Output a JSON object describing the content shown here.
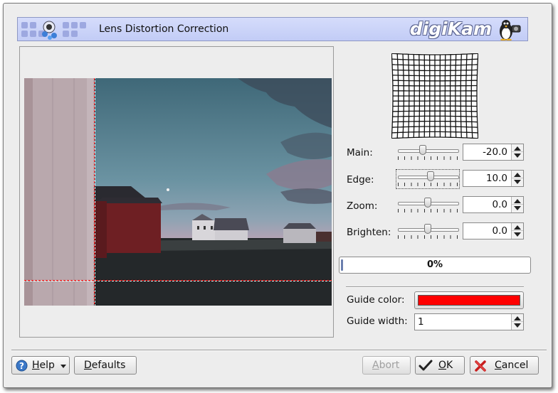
{
  "dialog": {
    "title": "Lens Distortion Correction",
    "logo_text": "digiKam"
  },
  "controls": {
    "main": {
      "label": "Main:",
      "value": "-20.0",
      "slider_fraction": 0.4
    },
    "edge": {
      "label": "Edge:",
      "value": "10.0",
      "slider_fraction": 0.55
    },
    "zoom": {
      "label": "Zoom:",
      "value": "0.0",
      "slider_fraction": 0.5
    },
    "brighten": {
      "label": "Brighten:",
      "value": "0.0",
      "slider_fraction": 0.5
    }
  },
  "progress": {
    "text": "0%",
    "value": 0
  },
  "guide": {
    "color_label": "Guide color:",
    "color": "#ff0000",
    "width_label": "Guide width:",
    "width_value": "1"
  },
  "buttons": {
    "help": "Help",
    "defaults": "Defaults",
    "abort": "Abort",
    "ok": "OK",
    "cancel": "Cancel"
  },
  "colors": {
    "banner": "#c8d0f8",
    "guide_line": "#ff0000",
    "progress_fill": "#6b7fae"
  }
}
